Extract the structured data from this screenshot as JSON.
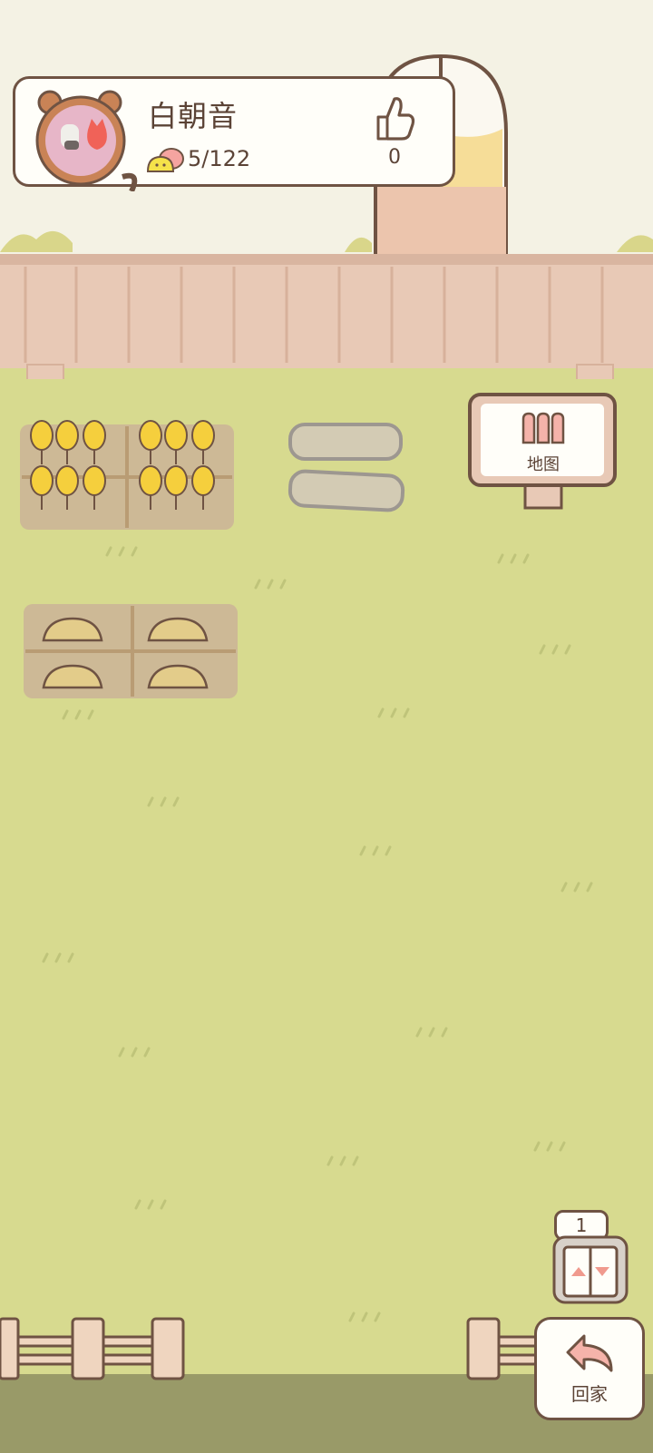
{
  "profile": {
    "player_name": "白朝音",
    "coins": "5/122",
    "likes": "0"
  },
  "map_sign": {
    "label": "地图"
  },
  "elevator": {
    "floor": "1"
  },
  "home_button": {
    "label": "回家"
  },
  "colors": {
    "grass": "#d7da8f",
    "sky": "#f4f2e4",
    "outline": "#6f5343",
    "fence": "#e8c9b6",
    "wheat": "#f5cf3d",
    "soil": "#cdb996",
    "accent_pink": "#f09a8e"
  },
  "icons": [
    "like-icon",
    "coin-icon",
    "map-gate-icon",
    "elevator-up-icon",
    "elevator-down-icon",
    "return-icon"
  ]
}
